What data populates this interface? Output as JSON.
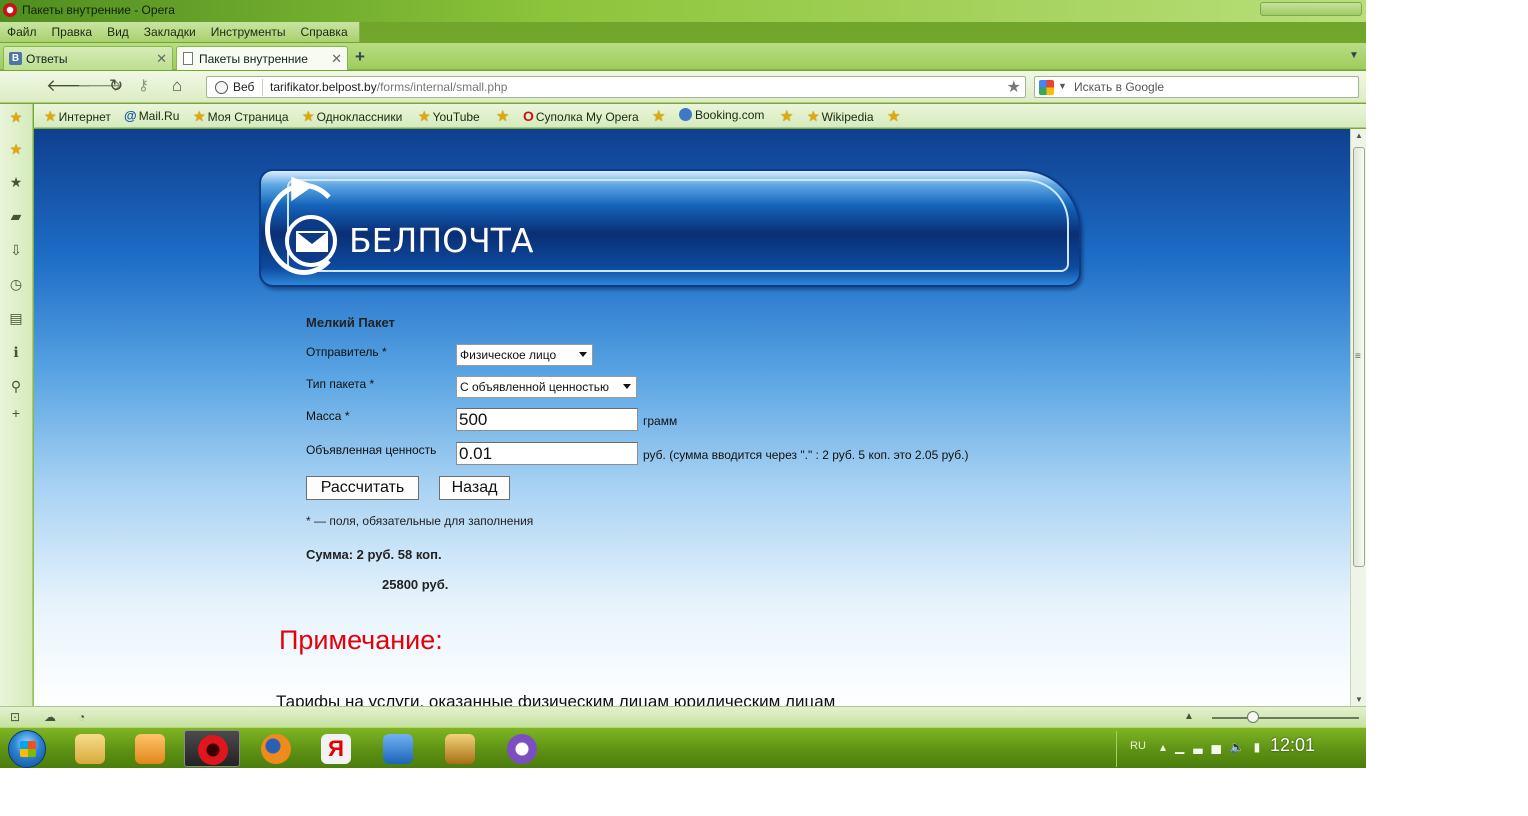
{
  "window": {
    "title": "Пакеты внутренние - Opera"
  },
  "menu": [
    "Файл",
    "Правка",
    "Вид",
    "Закладки",
    "Инструменты",
    "Справка"
  ],
  "tabs": [
    {
      "label": "Ответы",
      "icon": "vk-icon",
      "icon_text": "В",
      "active": false
    },
    {
      "label": "Пакеты внутренние",
      "icon": "page-icon",
      "active": true
    }
  ],
  "address": {
    "prefix": "Веб",
    "url_host": "tarifikator.belpost.by",
    "url_path": "/forms/internal/small.php",
    "search_placeholder": "Искать в Google"
  },
  "bookmarks": [
    {
      "label": "Интернет",
      "icon": "star-icon"
    },
    {
      "label": "Mail.Ru",
      "icon": "at-icon"
    },
    {
      "label": "Моя Страница",
      "icon": "star-icon"
    },
    {
      "label": "Одноклассники",
      "icon": "star-icon"
    },
    {
      "label": "YouTube",
      "icon": "star-icon"
    },
    {
      "label": "Суполка My Opera",
      "icon": "opera-icon"
    },
    {
      "label": "Booking.com",
      "icon": "booking-icon"
    },
    {
      "label": "Wikipedia",
      "icon": "star-icon"
    }
  ],
  "banner": {
    "logo_text": "БЕЛПОЧТА"
  },
  "form": {
    "title": "Мелкий Пакет",
    "sender_label": "Отправитель *",
    "sender_value": "Физическое лицо",
    "package_type_label": "Тип пакета *",
    "package_type_value": "С объявленной ценностью",
    "mass_label": "Масса *",
    "mass_value": "500",
    "mass_unit": "грамм",
    "declared_value_label": "Объявленная ценность",
    "declared_value": "0.01",
    "declared_value_note": "руб. (сумма вводится через \".\" : 2 руб. 5 коп. это 2.05 руб.)",
    "calculate_label": "Рассчитать",
    "back_label": "Назад",
    "required_note": "* — поля, обязательные для заполнения",
    "sum_line": "Сумма: 2 руб. 58 коп.",
    "sum_old": "25800 руб."
  },
  "page": {
    "note_heading": "Примечание:",
    "tariff_text": "Тарифы на услуги, оказанные физическим лицам юридическим лицам"
  },
  "taskbar": {
    "apps": [
      {
        "name": "explorer-icon",
        "color": "#e8c35a"
      },
      {
        "name": "media-player-icon",
        "color": "#f29a1d"
      },
      {
        "name": "opera-icon",
        "color": "#d4141c"
      },
      {
        "name": "firefox-icon",
        "color": "#e66a16"
      },
      {
        "name": "yandex-icon",
        "color": "#e8e8e8"
      },
      {
        "name": "mail-icon",
        "color": "#2f7fd0"
      },
      {
        "name": "game-icon",
        "color": "#c99222"
      },
      {
        "name": "viber-icon",
        "color": "#7b4fbf"
      }
    ],
    "lang": "RU",
    "clock": "12:01"
  },
  "colors": {
    "note_red": "#e5000b",
    "taskbar_green": "#5e9214",
    "page_blue": "#1d6cc6"
  }
}
